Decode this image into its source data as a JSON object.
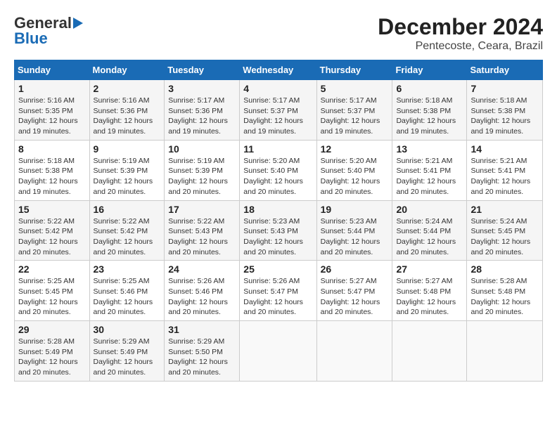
{
  "logo": {
    "line1": "General",
    "line2": "Blue"
  },
  "title": "December 2024",
  "subtitle": "Pentecoste, Ceara, Brazil",
  "days_header": [
    "Sunday",
    "Monday",
    "Tuesday",
    "Wednesday",
    "Thursday",
    "Friday",
    "Saturday"
  ],
  "weeks": [
    [
      {
        "day": "1",
        "info": "Sunrise: 5:16 AM\nSunset: 5:35 PM\nDaylight: 12 hours\nand 19 minutes."
      },
      {
        "day": "2",
        "info": "Sunrise: 5:16 AM\nSunset: 5:36 PM\nDaylight: 12 hours\nand 19 minutes."
      },
      {
        "day": "3",
        "info": "Sunrise: 5:17 AM\nSunset: 5:36 PM\nDaylight: 12 hours\nand 19 minutes."
      },
      {
        "day": "4",
        "info": "Sunrise: 5:17 AM\nSunset: 5:37 PM\nDaylight: 12 hours\nand 19 minutes."
      },
      {
        "day": "5",
        "info": "Sunrise: 5:17 AM\nSunset: 5:37 PM\nDaylight: 12 hours\nand 19 minutes."
      },
      {
        "day": "6",
        "info": "Sunrise: 5:18 AM\nSunset: 5:38 PM\nDaylight: 12 hours\nand 19 minutes."
      },
      {
        "day": "7",
        "info": "Sunrise: 5:18 AM\nSunset: 5:38 PM\nDaylight: 12 hours\nand 19 minutes."
      }
    ],
    [
      {
        "day": "8",
        "info": "Sunrise: 5:18 AM\nSunset: 5:38 PM\nDaylight: 12 hours\nand 19 minutes."
      },
      {
        "day": "9",
        "info": "Sunrise: 5:19 AM\nSunset: 5:39 PM\nDaylight: 12 hours\nand 20 minutes."
      },
      {
        "day": "10",
        "info": "Sunrise: 5:19 AM\nSunset: 5:39 PM\nDaylight: 12 hours\nand 20 minutes."
      },
      {
        "day": "11",
        "info": "Sunrise: 5:20 AM\nSunset: 5:40 PM\nDaylight: 12 hours\nand 20 minutes."
      },
      {
        "day": "12",
        "info": "Sunrise: 5:20 AM\nSunset: 5:40 PM\nDaylight: 12 hours\nand 20 minutes."
      },
      {
        "day": "13",
        "info": "Sunrise: 5:21 AM\nSunset: 5:41 PM\nDaylight: 12 hours\nand 20 minutes."
      },
      {
        "day": "14",
        "info": "Sunrise: 5:21 AM\nSunset: 5:41 PM\nDaylight: 12 hours\nand 20 minutes."
      }
    ],
    [
      {
        "day": "15",
        "info": "Sunrise: 5:22 AM\nSunset: 5:42 PM\nDaylight: 12 hours\nand 20 minutes."
      },
      {
        "day": "16",
        "info": "Sunrise: 5:22 AM\nSunset: 5:42 PM\nDaylight: 12 hours\nand 20 minutes."
      },
      {
        "day": "17",
        "info": "Sunrise: 5:22 AM\nSunset: 5:43 PM\nDaylight: 12 hours\nand 20 minutes."
      },
      {
        "day": "18",
        "info": "Sunrise: 5:23 AM\nSunset: 5:43 PM\nDaylight: 12 hours\nand 20 minutes."
      },
      {
        "day": "19",
        "info": "Sunrise: 5:23 AM\nSunset: 5:44 PM\nDaylight: 12 hours\nand 20 minutes."
      },
      {
        "day": "20",
        "info": "Sunrise: 5:24 AM\nSunset: 5:44 PM\nDaylight: 12 hours\nand 20 minutes."
      },
      {
        "day": "21",
        "info": "Sunrise: 5:24 AM\nSunset: 5:45 PM\nDaylight: 12 hours\nand 20 minutes."
      }
    ],
    [
      {
        "day": "22",
        "info": "Sunrise: 5:25 AM\nSunset: 5:45 PM\nDaylight: 12 hours\nand 20 minutes."
      },
      {
        "day": "23",
        "info": "Sunrise: 5:25 AM\nSunset: 5:46 PM\nDaylight: 12 hours\nand 20 minutes."
      },
      {
        "day": "24",
        "info": "Sunrise: 5:26 AM\nSunset: 5:46 PM\nDaylight: 12 hours\nand 20 minutes."
      },
      {
        "day": "25",
        "info": "Sunrise: 5:26 AM\nSunset: 5:47 PM\nDaylight: 12 hours\nand 20 minutes."
      },
      {
        "day": "26",
        "info": "Sunrise: 5:27 AM\nSunset: 5:47 PM\nDaylight: 12 hours\nand 20 minutes."
      },
      {
        "day": "27",
        "info": "Sunrise: 5:27 AM\nSunset: 5:48 PM\nDaylight: 12 hours\nand 20 minutes."
      },
      {
        "day": "28",
        "info": "Sunrise: 5:28 AM\nSunset: 5:48 PM\nDaylight: 12 hours\nand 20 minutes."
      }
    ],
    [
      {
        "day": "29",
        "info": "Sunrise: 5:28 AM\nSunset: 5:49 PM\nDaylight: 12 hours\nand 20 minutes."
      },
      {
        "day": "30",
        "info": "Sunrise: 5:29 AM\nSunset: 5:49 PM\nDaylight: 12 hours\nand 20 minutes."
      },
      {
        "day": "31",
        "info": "Sunrise: 5:29 AM\nSunset: 5:50 PM\nDaylight: 12 hours\nand 20 minutes."
      },
      {
        "day": "",
        "info": ""
      },
      {
        "day": "",
        "info": ""
      },
      {
        "day": "",
        "info": ""
      },
      {
        "day": "",
        "info": ""
      }
    ]
  ]
}
